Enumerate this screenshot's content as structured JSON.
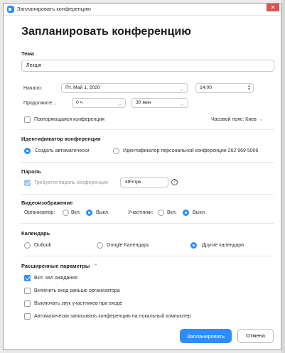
{
  "window": {
    "title": "Запланировать конференцию",
    "close_glyph": "✕"
  },
  "heading": "Запланировать конференцию",
  "topic": {
    "label": "Тема",
    "value": "Лекція"
  },
  "schedule": {
    "start_label": "Начало:",
    "date_value": "Пт. Май 1, 2020",
    "time_value": "14:00",
    "duration_label": "Продолжите...",
    "hours_value": "0 ч",
    "minutes_value": "30 мин",
    "recurring_label": "Повторяющаяся конференция",
    "timezone_label": "Часовой пояс: Киев"
  },
  "meeting_id": {
    "section_label": "Идентификатор конференции",
    "auto_label": "Создать автоматически",
    "personal_label": "Идентификатор персональной конференции 262 969 5006"
  },
  "password": {
    "section_label": "Пароль",
    "require_label": "Требуется пароль конференции",
    "value": "4fFmpk",
    "help_glyph": "?"
  },
  "video": {
    "section_label": "Видеоизображение",
    "host_label": "Организатор:",
    "participants_label": "Участники:",
    "on_label": "Вкл.",
    "off_label": "Выкл."
  },
  "calendar": {
    "section_label": "Календарь",
    "outlook_label": "Outlook",
    "google_label": "Google Календарь",
    "other_label": "Другие календари"
  },
  "advanced": {
    "section_label": "Расширенные параметры",
    "toggle_glyph": "⌃",
    "waiting_room_label": "Вкл. зал ожидания",
    "join_before_host_label": "Включить вход раньше организатора",
    "mute_on_entry_label": "Выключать звук участников при входе",
    "auto_record_label": "Автоматически записывать конференцию на локальный компьютер"
  },
  "actions": {
    "schedule_label": "Запланировать",
    "cancel_label": "Отмена"
  },
  "colors": {
    "accent": "#2d8cff"
  }
}
